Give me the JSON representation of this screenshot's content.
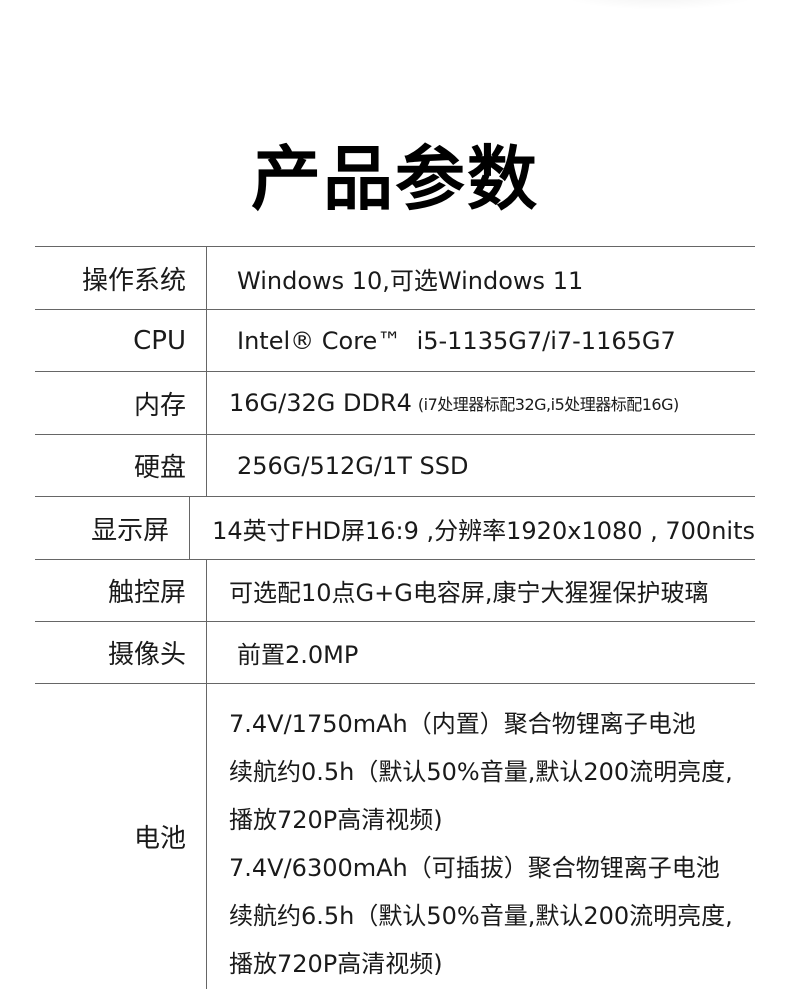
{
  "page": {
    "title": "产品参数"
  },
  "specs": {
    "os": {
      "label": "操作系统",
      "value": "Windows 10,可选Windows 11"
    },
    "cpu": {
      "label": "CPU",
      "value": "Intel® Core™  i5-1135G7/i7-1165G7"
    },
    "memory": {
      "label": "内存",
      "value": "16G/32G DDR4",
      "note": "(i7处理器标配32G,i5处理器标配16G)"
    },
    "storage": {
      "label": "硬盘",
      "value": "256G/512G/1T SSD"
    },
    "display": {
      "label": "显示屏",
      "value": "14英寸FHD屏16:9 ,分辨率1920x1080 , 700nits"
    },
    "touchscreen": {
      "label": "触控屏",
      "value": "可选配10点G+G电容屏,康宁大猩猩保护玻璃"
    },
    "camera": {
      "label": "摄像头",
      "value": "前置2.0MP"
    },
    "battery": {
      "label": "电池",
      "lines": [
        "7.4V/1750mAh（内置）聚合物锂离子电池",
        "续航约0.5h（默认50%音量,默认200流明亮度,",
        "播放720P高清视频)",
        "7.4V/6300mAh（可插拔）聚合物锂离子电池",
        "续航约6.5h（默认50%音量,默认200流明亮度,",
        "播放720P高清视频)"
      ]
    }
  }
}
